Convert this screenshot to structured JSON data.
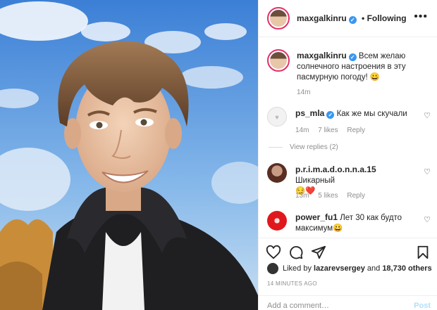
{
  "header": {
    "username": "maxgalkinru",
    "follow_label": "• Following",
    "more_label": "•••"
  },
  "caption": {
    "username": "maxgalkinru",
    "text": "Всем желаю солнечного настроения в эту пасмурную погоду! 😀",
    "time": "14m"
  },
  "comments": [
    {
      "username": "ps_mla",
      "text": "Как же мы скучали",
      "time": "14m",
      "likes": "7 likes",
      "reply": "Reply",
      "view_replies": "View replies (2)"
    },
    {
      "username": "p.r.i.m.a.d.o.n.n.a.15",
      "text": "Шикарный",
      "emoji": "😏❤️",
      "time": "13m",
      "likes": "5 likes",
      "reply": "Reply"
    },
    {
      "username": "power_fu1",
      "text": "Лет 30 как будто максимум😀"
    }
  ],
  "likes": {
    "prefix": "Liked by",
    "user": "lazarevsergey",
    "and": "and",
    "count": "18,730 others"
  },
  "timestamp": "14 MINUTES AGO",
  "add_comment": {
    "placeholder": "Add a comment…",
    "post_label": "Post"
  },
  "icons": [
    "heart-icon",
    "comment-icon",
    "share-icon",
    "bookmark-icon",
    "verified-icon",
    "more-icon"
  ],
  "colors": {
    "verified": "#3897f0",
    "like_heart": "#ed4956",
    "post_button": "#b2dffc"
  }
}
